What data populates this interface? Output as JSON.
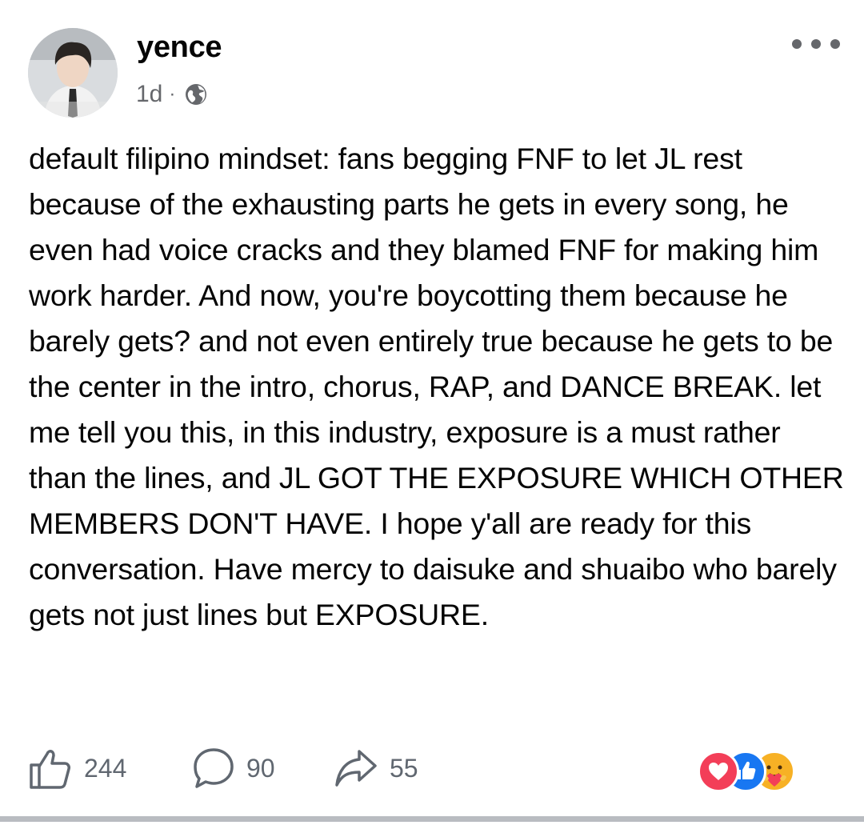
{
  "post": {
    "author": "yence",
    "time": "1d",
    "separator": "·",
    "audience_icon": "globe-icon",
    "body": "default filipino mindset: fans begging FNF to let JL rest because of the exhausting parts he gets in every song, he even had voice cracks and they blamed FNF for making him work harder. And now, you're boycotting them because he barely gets? and not even entirely true because he gets to be the center in the intro, chorus, RAP, and DANCE BREAK. let me tell you this, in this industry, exposure is a must rather than the lines, and JL GOT THE EXPOSURE WHICH OTHER MEMBERS DON'T HAVE. I hope y'all are ready for this conversation. Have mercy to daisuke and shuaibo who barely gets not just lines but EXPOSURE."
  },
  "actions": {
    "likes": "244",
    "comments": "90",
    "shares": "55"
  },
  "reactions": [
    "love",
    "like",
    "care"
  ],
  "colors": {
    "text": "#050505",
    "meta": "#65676b",
    "like_blue": "#1877f2",
    "love_red": "#f33e58",
    "care_yellow": "#f7b125"
  }
}
